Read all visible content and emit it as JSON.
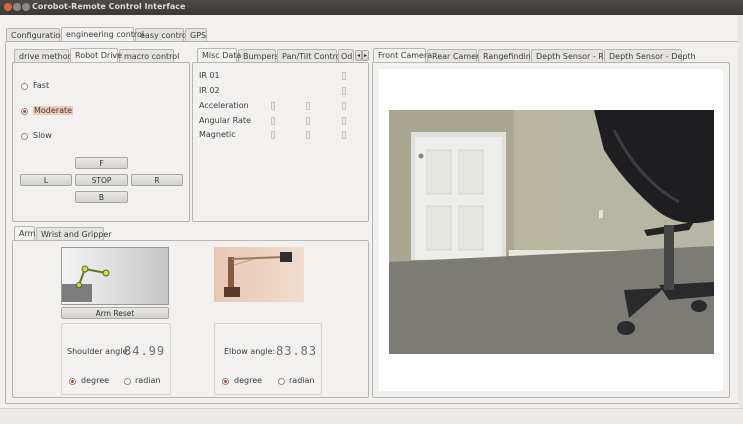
{
  "window": {
    "title": "Corobot-Remote Control Interface"
  },
  "main_tabs": [
    "Configuration",
    "engineering control",
    "easy control",
    "GPS"
  ],
  "drive_tabs": [
    "drive methods",
    "Robot Drive",
    "macro control"
  ],
  "speed": {
    "options": [
      "Fast",
      "Moderate",
      "Slow"
    ],
    "selected": "Moderate"
  },
  "drive_buttons": {
    "forward": "F",
    "left": "L",
    "stop": "STOP",
    "right": "R",
    "back": "B"
  },
  "sensor_tabs": [
    "Misc Data",
    "Bumpers",
    "Pan/Tilt Control",
    "Od"
  ],
  "sensor_rows": [
    "IR 01",
    "IR 02",
    "Acceleration",
    "Angular Rate",
    "Magnetic"
  ],
  "camera_tabs": [
    "Front Camera",
    "Rear Camera",
    "Rangefinding",
    "Depth Sensor - RGB",
    "Depth Sensor - Depth"
  ],
  "arm_tabs": [
    "Arm",
    "Wrist and Gripper"
  ],
  "arm": {
    "reset_label": "Arm Reset",
    "shoulder_label": "Shoulder angle:",
    "shoulder_value": "84.99",
    "elbow_label": "Elbow angle:",
    "elbow_value": "83.83",
    "unit_options": [
      "degree",
      "radian"
    ],
    "shoulder_unit": "degree",
    "elbow_unit": "degree"
  },
  "icons": [
    "close-icon",
    "minimize-icon",
    "maximize-icon",
    "tab-scroll-left-icon",
    "tab-scroll-right-icon"
  ]
}
